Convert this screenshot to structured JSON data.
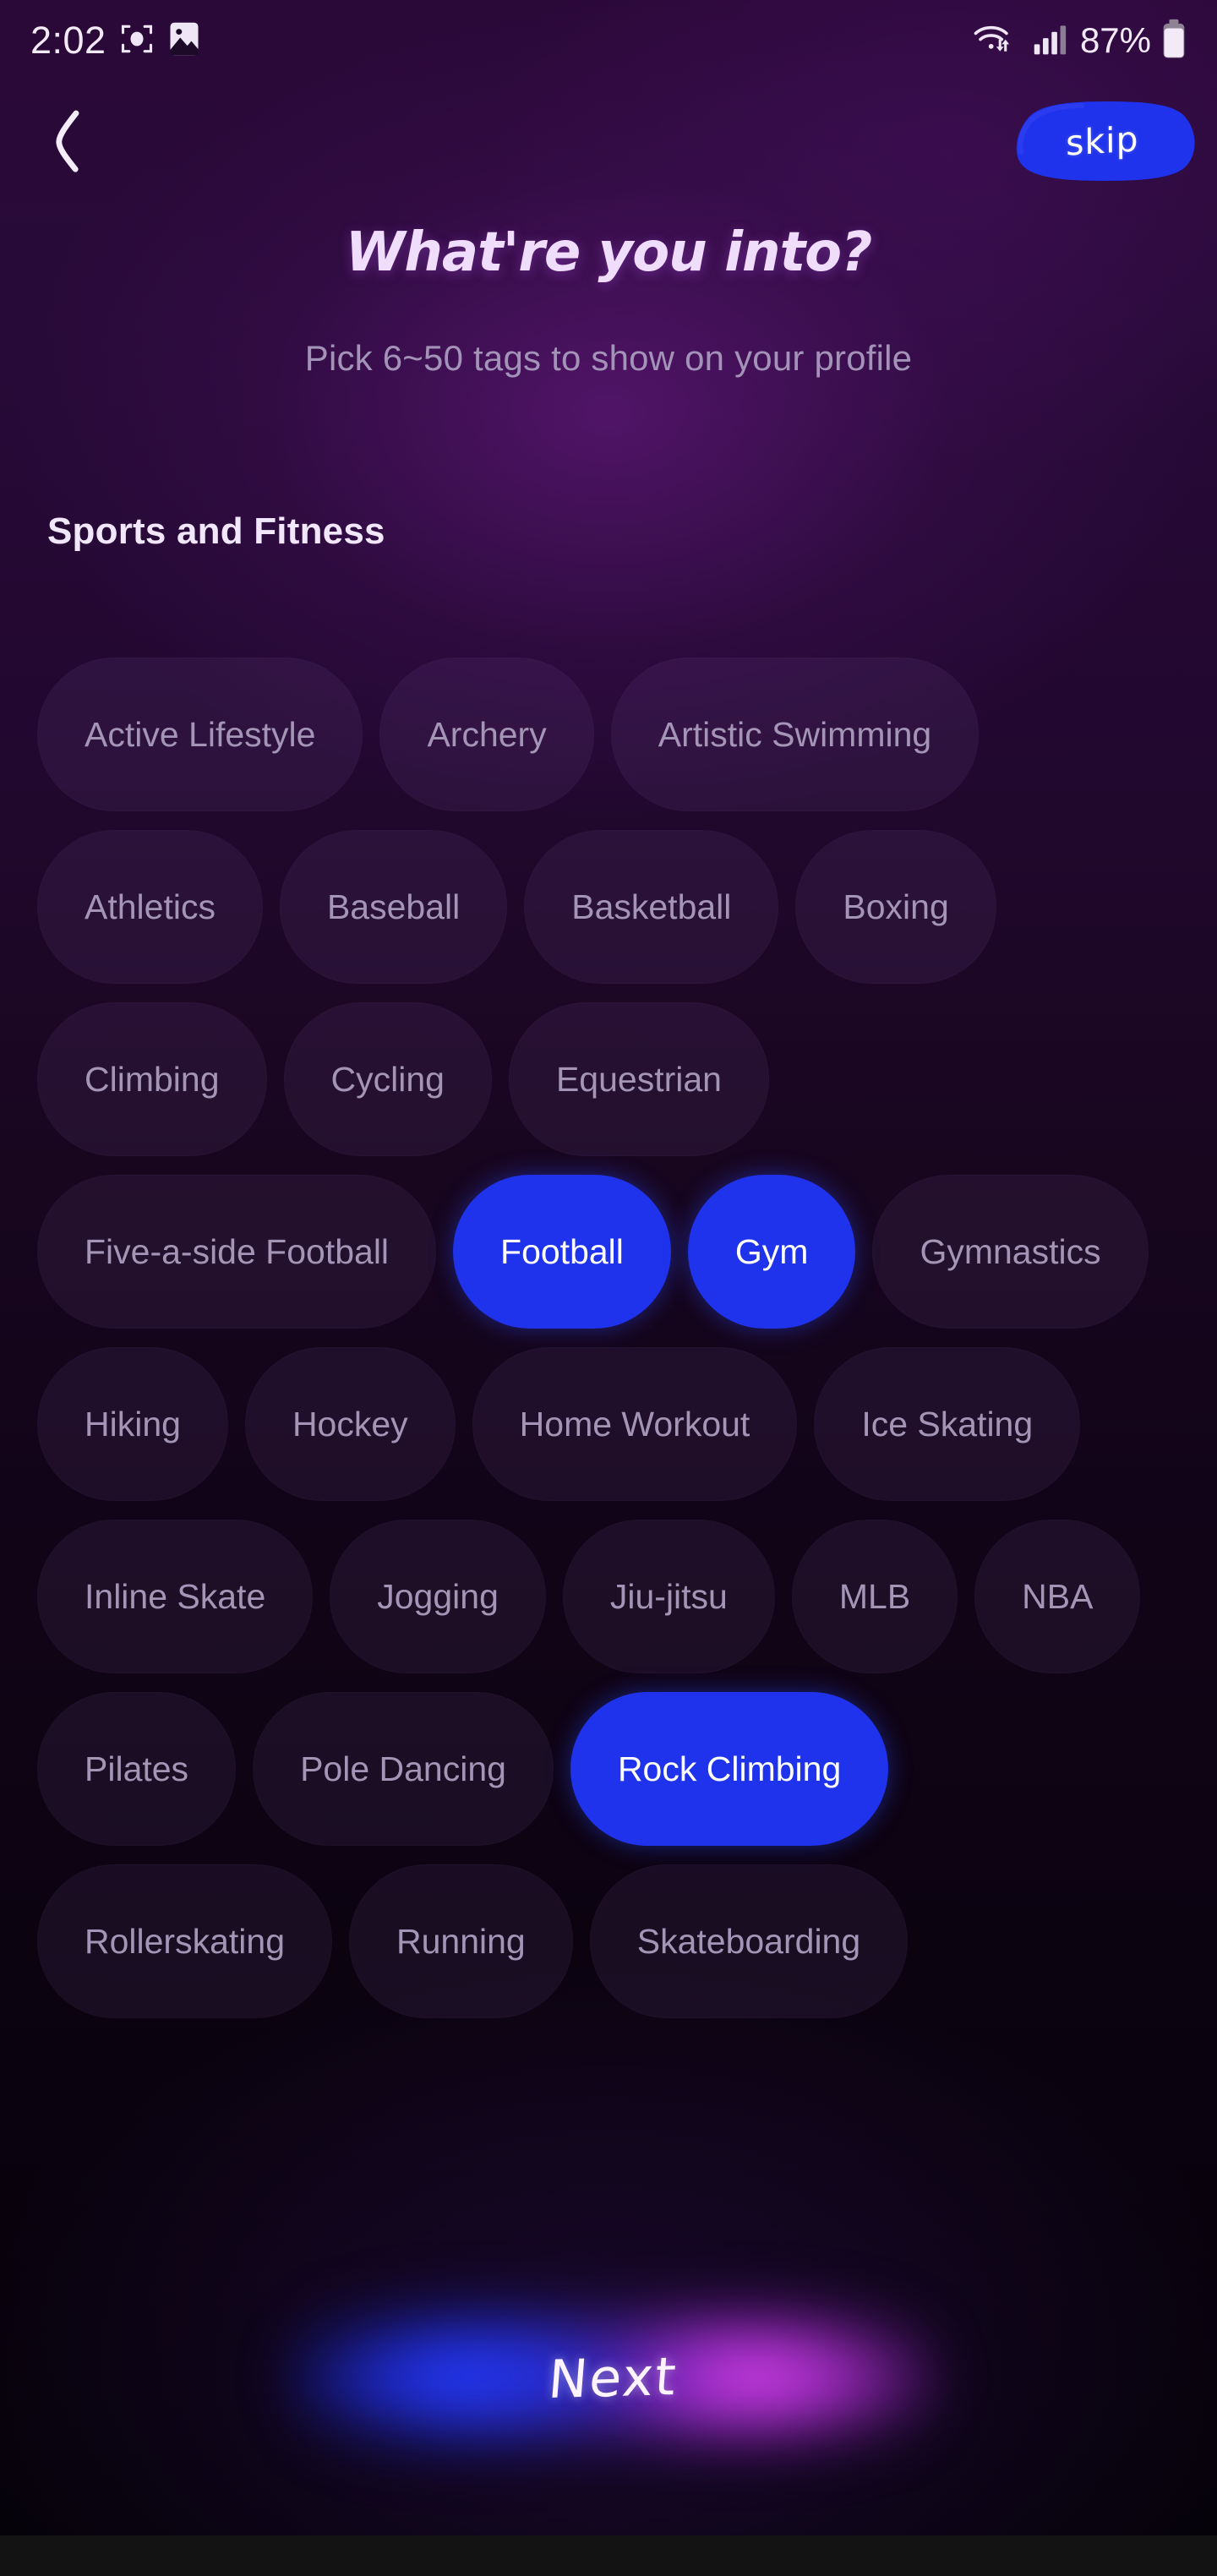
{
  "status_bar": {
    "time": "2:02",
    "battery_percent": "87%",
    "icons": [
      "screen-capture-icon",
      "gallery-image-icon",
      "wifi-icon",
      "cellular-signal-icon",
      "battery-icon"
    ]
  },
  "header": {
    "back_label": "back-chevron",
    "skip_label": "skip"
  },
  "page": {
    "title": "What're you into?",
    "subtitle": "Pick 6~50 tags to show on your profile"
  },
  "section": {
    "title": "Sports and Fitness"
  },
  "tags": [
    {
      "label": "Active Lifestyle",
      "selected": false
    },
    {
      "label": "Archery",
      "selected": false
    },
    {
      "label": "Artistic Swimming",
      "selected": false
    },
    {
      "label": "Athletics",
      "selected": false
    },
    {
      "label": "Baseball",
      "selected": false
    },
    {
      "label": "Basketball",
      "selected": false
    },
    {
      "label": "Boxing",
      "selected": false
    },
    {
      "label": "Climbing",
      "selected": false
    },
    {
      "label": "Cycling",
      "selected": false
    },
    {
      "label": "Equestrian",
      "selected": false
    },
    {
      "label": "Five-a-side Football",
      "selected": false
    },
    {
      "label": "Football",
      "selected": true
    },
    {
      "label": "Gym",
      "selected": true
    },
    {
      "label": "Gymnastics",
      "selected": false
    },
    {
      "label": "Hiking",
      "selected": false
    },
    {
      "label": "Hockey",
      "selected": false
    },
    {
      "label": "Home Workout",
      "selected": false
    },
    {
      "label": "Ice Skating",
      "selected": false
    },
    {
      "label": "Inline Skate",
      "selected": false
    },
    {
      "label": "Jogging",
      "selected": false
    },
    {
      "label": "Jiu-jitsu",
      "selected": false
    },
    {
      "label": "MLB",
      "selected": false
    },
    {
      "label": "NBA",
      "selected": false
    },
    {
      "label": "Pilates",
      "selected": false
    },
    {
      "label": "Pole Dancing",
      "selected": false
    },
    {
      "label": "Rock Climbing",
      "selected": true
    },
    {
      "label": "Rollerskating",
      "selected": false
    },
    {
      "label": "Running",
      "selected": false
    },
    {
      "label": "Skateboarding",
      "selected": false
    }
  ],
  "footer": {
    "next_label": "Next"
  },
  "colors": {
    "accent_blue": "#1f33ec",
    "glow_magenta": "#de42f2",
    "background_top": "#2a0838",
    "background_bottom": "#050209",
    "tag_text_off": "#a495b6",
    "title_text": "#f0dcfb"
  }
}
